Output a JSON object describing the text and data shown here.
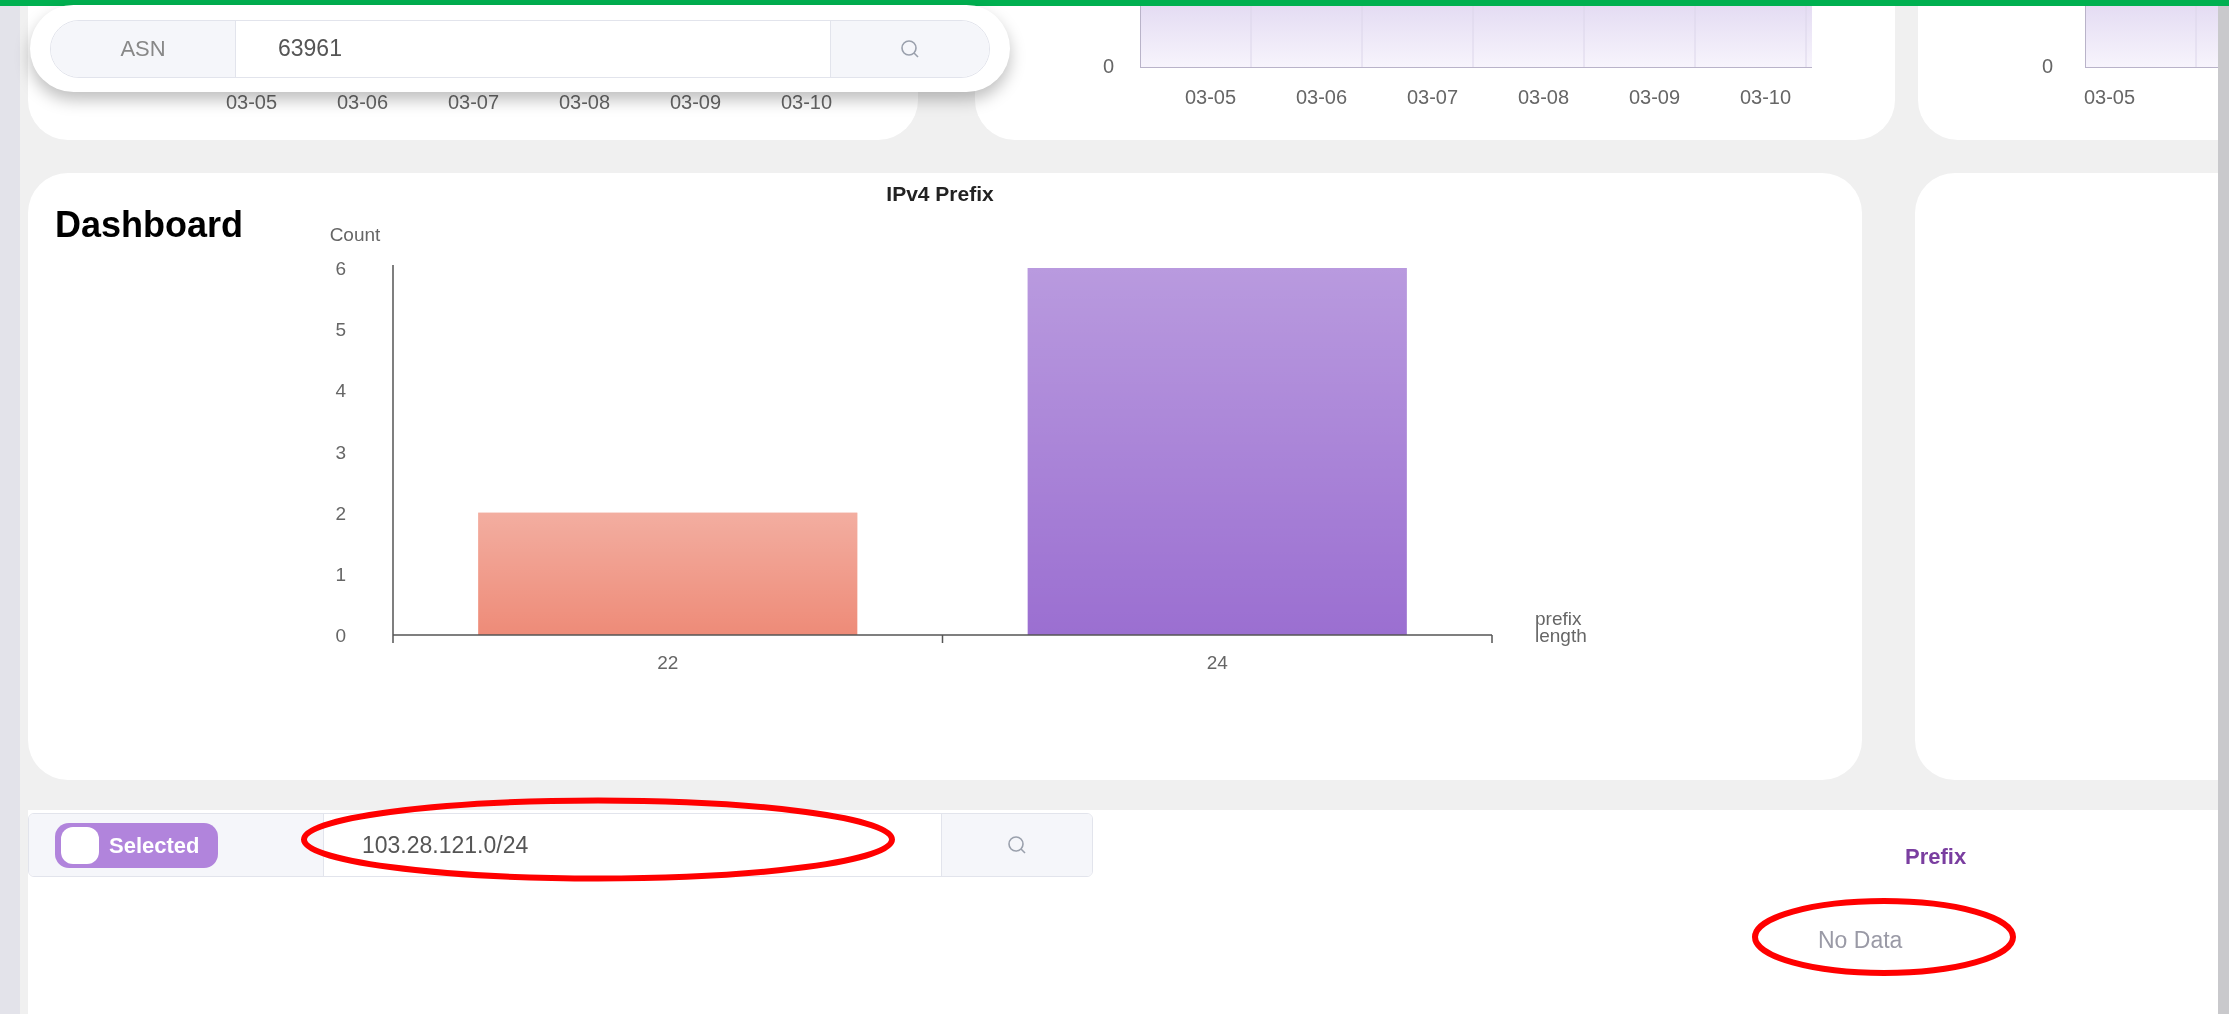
{
  "asn_search": {
    "label": "ASN",
    "value": "63961"
  },
  "top_charts": [
    {
      "x_labels": [
        "03-05",
        "03-06",
        "03-07",
        "03-08",
        "03-09",
        "03-10"
      ]
    },
    {
      "y_tick": "0",
      "x_labels": [
        "03-05",
        "03-06",
        "03-07",
        "03-08",
        "03-09",
        "03-10"
      ]
    },
    {
      "y_tick": "0",
      "x_labels": [
        "03-05"
      ]
    }
  ],
  "annotation_label": "Dashboard",
  "prefix_chart": {
    "chart_data": {
      "type": "bar",
      "title": "IPv4 Prefix",
      "ylabel": "Count",
      "xlabel": "prefix length",
      "categories": [
        "22",
        "24"
      ],
      "series": [
        {
          "color": "#ee8b78",
          "values": [
            2,
            null
          ]
        },
        {
          "color": "#9b6fd1",
          "values": [
            null,
            6
          ]
        }
      ],
      "ylim": [
        0,
        6
      ],
      "yticks": [
        0,
        1,
        2,
        3,
        4,
        5,
        6
      ]
    }
  },
  "prefix_search": {
    "toggle": {
      "label": "Selected",
      "on": true
    },
    "value": "103.28.121.0/24"
  },
  "prefix_table": {
    "column": "Prefix",
    "empty_text": "No Data"
  }
}
